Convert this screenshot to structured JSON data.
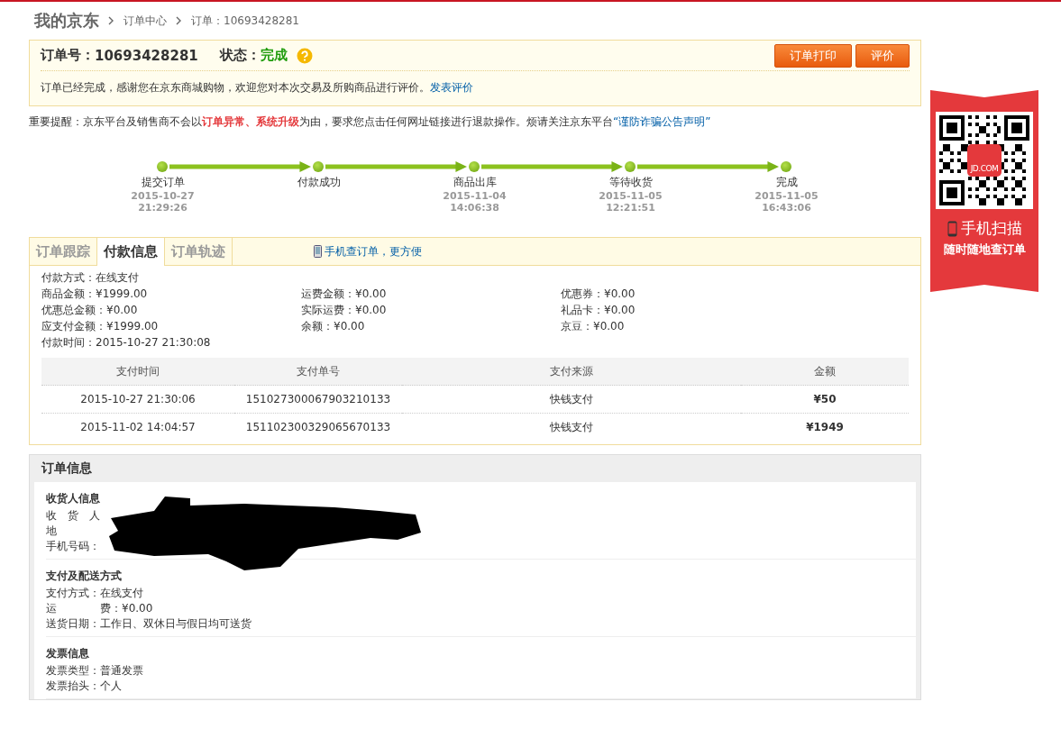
{
  "breadcrumb": {
    "title": "我的京东",
    "items": [
      "订单中心",
      "订单：10693428281"
    ]
  },
  "order": {
    "number_label": "订单号：",
    "number": "10693428281",
    "status_label": "状态：",
    "status": "完成",
    "buttons": [
      "订单打印",
      "评价"
    ],
    "message": "订单已经完成，感谢您在京东商城购物，欢迎您对本次交易及所购商品进行评价。",
    "message_link": "发表评价"
  },
  "notice": {
    "text": "重要提醒：京东平台及销售商不会以**订单异常、系统升级**为由，要求您点击任何网址链接进行退款操作。烦请关注京东平台",
    "link": "“谨防诈骗公告声明”"
  },
  "progress": [
    {
      "label": "提交订单",
      "date": "2015-10-27",
      "time": "21:29:26",
      "done": true
    },
    {
      "label": "付款成功",
      "done": true
    },
    {
      "label": "商品出库",
      "date": "2015-11-04",
      "time": "14:06:38",
      "done": true
    },
    {
      "label": "等待收货",
      "date": "2015-11-05",
      "time": "12:21:51",
      "done": true
    },
    {
      "label": "完成",
      "date": "2015-11-05",
      "time": "16:43:06",
      "done": true
    }
  ],
  "tabs": [
    {
      "label": "订单跟踪",
      "selected": false
    },
    {
      "label": "付款信息",
      "selected": true
    },
    {
      "label": "订单轨迹",
      "selected": false
    }
  ],
  "mobile_link": "手机查订单，更方便",
  "payment": {
    "method": "付款方式：在线支付",
    "fields": [
      "商品金额：¥1999.00",
      "运费金额：¥0.00",
      "优惠券：¥0.00",
      "优惠总金额：¥0.00",
      "实际运费：¥0.00",
      "礼品卡：¥0.00",
      "应支付金额：¥1999.00",
      "余额：¥0.00",
      "京豆：¥0.00"
    ],
    "time": "付款时间：2015-10-27 21:30:08",
    "table": {
      "columns": [
        "支付时间",
        "支付单号",
        "支付来源",
        "金额"
      ],
      "rows": [
        [
          "2015-10-27 21:30:06",
          "151027300067903210133",
          "快钱支付",
          "¥50"
        ],
        [
          "2015-11-02 14:04:57",
          "151102300329065670133",
          "快钱支付",
          "¥1949"
        ]
      ]
    }
  },
  "order_info": {
    "title": "订单信息",
    "sections": [
      {
        "title": "收货人信息",
        "redacted": true,
        "lines": [
          "收　货　人",
          "地",
          "手机号码："
        ]
      },
      {
        "title": "支付及配送方式",
        "redacted": false,
        "lines": [
          "支付方式：在线支付",
          "运　　　　费：¥0.00",
          "送货日期：工作日、双休日与假日均可送货"
        ]
      },
      {
        "title": "发票信息",
        "redacted": false,
        "lines": [
          "发票类型：普通发票",
          "发票抬头：个人"
        ]
      }
    ]
  },
  "side_ad": {
    "logo": "JD.COM",
    "title": "手机扫描",
    "subtitle": "随时随地查订单"
  }
}
